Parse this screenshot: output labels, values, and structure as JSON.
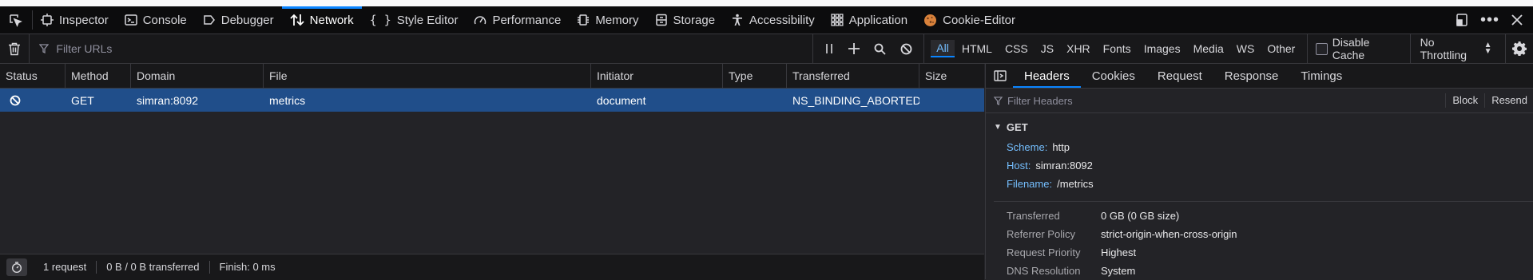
{
  "toolbox": {
    "tabs": [
      {
        "label": "Inspector",
        "icon": "inspector-icon"
      },
      {
        "label": "Console",
        "icon": "console-icon"
      },
      {
        "label": "Debugger",
        "icon": "debugger-icon"
      },
      {
        "label": "Network",
        "icon": "network-icon",
        "active": true
      },
      {
        "label": "Style Editor",
        "icon": "style-editor-icon"
      },
      {
        "label": "Performance",
        "icon": "performance-icon"
      },
      {
        "label": "Memory",
        "icon": "memory-icon"
      },
      {
        "label": "Storage",
        "icon": "storage-icon"
      },
      {
        "label": "Accessibility",
        "icon": "accessibility-icon"
      },
      {
        "label": "Application",
        "icon": "application-icon"
      },
      {
        "label": "Cookie-Editor",
        "icon": "cookie-icon"
      }
    ]
  },
  "network": {
    "filter_placeholder": "Filter URLs",
    "types": [
      "All",
      "HTML",
      "CSS",
      "JS",
      "XHR",
      "Fonts",
      "Images",
      "Media",
      "WS",
      "Other"
    ],
    "active_type": "All",
    "disable_cache_label": "Disable Cache",
    "disable_cache_checked": false,
    "throttling_label": "No Throttling"
  },
  "table": {
    "columns": [
      "Status",
      "Method",
      "Domain",
      "File",
      "Initiator",
      "Type",
      "Transferred",
      "Size"
    ],
    "rows": [
      {
        "status_icon": "blocked-icon",
        "method": "GET",
        "domain": "simran:8092",
        "file": "metrics",
        "initiator": "document",
        "type": "",
        "transferred": "NS_BINDING_ABORTED",
        "size": ""
      }
    ]
  },
  "statusbar": {
    "requests": "1 request",
    "transferred": "0 B / 0 B transferred",
    "finish": "Finish: 0 ms"
  },
  "details": {
    "tabs": [
      "Headers",
      "Cookies",
      "Request",
      "Response",
      "Timings"
    ],
    "active_tab": "Headers",
    "filter_placeholder": "Filter Headers",
    "block_label": "Block",
    "resend_label": "Resend",
    "section_title": "GET",
    "url_parts": [
      {
        "key": "Scheme:",
        "value": "http"
      },
      {
        "key": "Host:",
        "value": "simran:8092"
      },
      {
        "key": "Filename:",
        "value": "/metrics"
      }
    ],
    "meta": [
      {
        "key": "Transferred",
        "value": "0 GB (0 GB size)"
      },
      {
        "key": "Referrer Policy",
        "value": "strict-origin-when-cross-origin"
      },
      {
        "key": "Request Priority",
        "value": "Highest"
      },
      {
        "key": "DNS Resolution",
        "value": "System"
      }
    ]
  },
  "colors": {
    "accent": "#0a84ff",
    "selected_row": "#204e8a",
    "background": "#232327"
  }
}
